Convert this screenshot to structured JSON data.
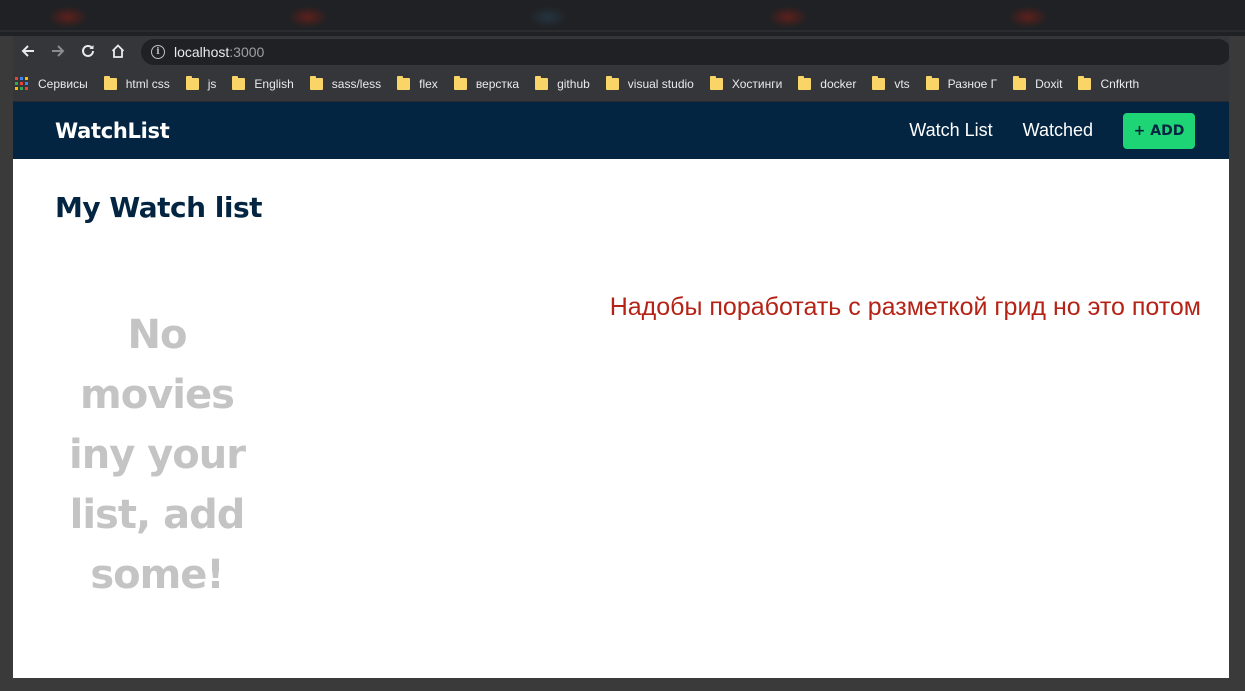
{
  "browser": {
    "url_host": "localhost",
    "url_port": ":3000",
    "apps_label": "Сервисы",
    "bookmarks": [
      {
        "label": "html css"
      },
      {
        "label": "js"
      },
      {
        "label": "English"
      },
      {
        "label": "sass/less"
      },
      {
        "label": "flex"
      },
      {
        "label": "верстка"
      },
      {
        "label": "github"
      },
      {
        "label": "visual studio"
      },
      {
        "label": "Хостинги"
      },
      {
        "label": "docker"
      },
      {
        "label": "vts"
      },
      {
        "label": "Разное Г"
      },
      {
        "label": "Doxit"
      },
      {
        "label": "Cnfkrth"
      }
    ]
  },
  "site": {
    "brand": "WatchList",
    "nav": {
      "watch_list": "Watch List",
      "watched": "Watched",
      "add": "+ ADD"
    },
    "page_title": "My Watch list",
    "empty_message": "No movies iny your list, add some!",
    "note": "Надобы поработать с разметкой грид но это потом"
  },
  "colors": {
    "header_bg": "#032541",
    "accent": "#1ed576",
    "note_text": "#b42316",
    "empty_text": "#c4c4c4"
  }
}
